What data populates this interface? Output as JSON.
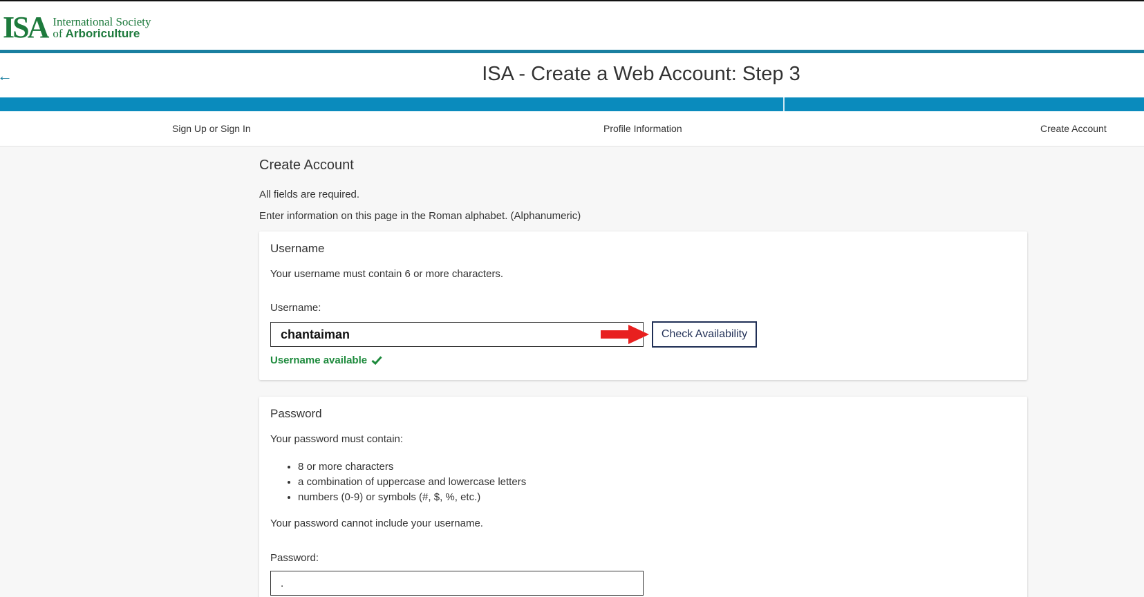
{
  "brand": {
    "logo_mark": "ISA",
    "name_line1": "International Society",
    "name_of": "of",
    "name_line2": "Arboriculture",
    "primary_color": "#1d7a3c",
    "accent_color": "#0a8bbd"
  },
  "header": {
    "back_icon": "arrow-left-icon",
    "title": "ISA - Create a Web Account: Step 3"
  },
  "steps": [
    "Sign Up or Sign In",
    "Profile Information",
    "Create Account"
  ],
  "page": {
    "heading": "Create Account",
    "required_note": "All fields are required.",
    "alphabet_note": "Enter information on this page in the Roman alphabet. (Alphanumeric)"
  },
  "username_card": {
    "title": "Username",
    "description": "Your username must contain 6 or more characters.",
    "field_label": "Username:",
    "value": "chantaiman",
    "check_button": "Check Availability",
    "status": "Username available",
    "status_color": "#1d8a3c"
  },
  "password_card": {
    "title": "Password",
    "intro": "Your password must contain:",
    "rules": [
      "8 or more characters",
      "a combination of uppercase and lowercase letters",
      "numbers (0-9) or symbols (#, $, %, etc.)"
    ],
    "note": "Your password cannot include your username.",
    "field_label": "Password:",
    "value": "."
  }
}
